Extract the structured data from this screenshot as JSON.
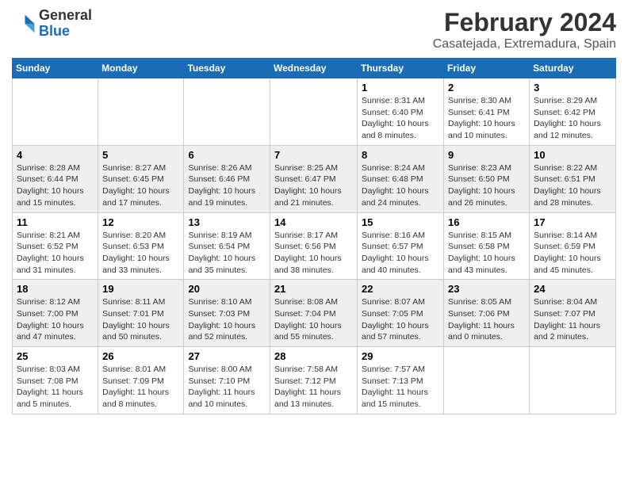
{
  "header": {
    "logo_general": "General",
    "logo_blue": "Blue",
    "month": "February 2024",
    "location": "Casatejada, Extremadura, Spain"
  },
  "columns": [
    "Sunday",
    "Monday",
    "Tuesday",
    "Wednesday",
    "Thursday",
    "Friday",
    "Saturday"
  ],
  "weeks": [
    [
      {
        "day": "",
        "info": ""
      },
      {
        "day": "",
        "info": ""
      },
      {
        "day": "",
        "info": ""
      },
      {
        "day": "",
        "info": ""
      },
      {
        "day": "1",
        "info": "Sunrise: 8:31 AM\nSunset: 6:40 PM\nDaylight: 10 hours\nand 8 minutes."
      },
      {
        "day": "2",
        "info": "Sunrise: 8:30 AM\nSunset: 6:41 PM\nDaylight: 10 hours\nand 10 minutes."
      },
      {
        "day": "3",
        "info": "Sunrise: 8:29 AM\nSunset: 6:42 PM\nDaylight: 10 hours\nand 12 minutes."
      }
    ],
    [
      {
        "day": "4",
        "info": "Sunrise: 8:28 AM\nSunset: 6:44 PM\nDaylight: 10 hours\nand 15 minutes."
      },
      {
        "day": "5",
        "info": "Sunrise: 8:27 AM\nSunset: 6:45 PM\nDaylight: 10 hours\nand 17 minutes."
      },
      {
        "day": "6",
        "info": "Sunrise: 8:26 AM\nSunset: 6:46 PM\nDaylight: 10 hours\nand 19 minutes."
      },
      {
        "day": "7",
        "info": "Sunrise: 8:25 AM\nSunset: 6:47 PM\nDaylight: 10 hours\nand 21 minutes."
      },
      {
        "day": "8",
        "info": "Sunrise: 8:24 AM\nSunset: 6:48 PM\nDaylight: 10 hours\nand 24 minutes."
      },
      {
        "day": "9",
        "info": "Sunrise: 8:23 AM\nSunset: 6:50 PM\nDaylight: 10 hours\nand 26 minutes."
      },
      {
        "day": "10",
        "info": "Sunrise: 8:22 AM\nSunset: 6:51 PM\nDaylight: 10 hours\nand 28 minutes."
      }
    ],
    [
      {
        "day": "11",
        "info": "Sunrise: 8:21 AM\nSunset: 6:52 PM\nDaylight: 10 hours\nand 31 minutes."
      },
      {
        "day": "12",
        "info": "Sunrise: 8:20 AM\nSunset: 6:53 PM\nDaylight: 10 hours\nand 33 minutes."
      },
      {
        "day": "13",
        "info": "Sunrise: 8:19 AM\nSunset: 6:54 PM\nDaylight: 10 hours\nand 35 minutes."
      },
      {
        "day": "14",
        "info": "Sunrise: 8:17 AM\nSunset: 6:56 PM\nDaylight: 10 hours\nand 38 minutes."
      },
      {
        "day": "15",
        "info": "Sunrise: 8:16 AM\nSunset: 6:57 PM\nDaylight: 10 hours\nand 40 minutes."
      },
      {
        "day": "16",
        "info": "Sunrise: 8:15 AM\nSunset: 6:58 PM\nDaylight: 10 hours\nand 43 minutes."
      },
      {
        "day": "17",
        "info": "Sunrise: 8:14 AM\nSunset: 6:59 PM\nDaylight: 10 hours\nand 45 minutes."
      }
    ],
    [
      {
        "day": "18",
        "info": "Sunrise: 8:12 AM\nSunset: 7:00 PM\nDaylight: 10 hours\nand 47 minutes."
      },
      {
        "day": "19",
        "info": "Sunrise: 8:11 AM\nSunset: 7:01 PM\nDaylight: 10 hours\nand 50 minutes."
      },
      {
        "day": "20",
        "info": "Sunrise: 8:10 AM\nSunset: 7:03 PM\nDaylight: 10 hours\nand 52 minutes."
      },
      {
        "day": "21",
        "info": "Sunrise: 8:08 AM\nSunset: 7:04 PM\nDaylight: 10 hours\nand 55 minutes."
      },
      {
        "day": "22",
        "info": "Sunrise: 8:07 AM\nSunset: 7:05 PM\nDaylight: 10 hours\nand 57 minutes."
      },
      {
        "day": "23",
        "info": "Sunrise: 8:05 AM\nSunset: 7:06 PM\nDaylight: 11 hours\nand 0 minutes."
      },
      {
        "day": "24",
        "info": "Sunrise: 8:04 AM\nSunset: 7:07 PM\nDaylight: 11 hours\nand 2 minutes."
      }
    ],
    [
      {
        "day": "25",
        "info": "Sunrise: 8:03 AM\nSunset: 7:08 PM\nDaylight: 11 hours\nand 5 minutes."
      },
      {
        "day": "26",
        "info": "Sunrise: 8:01 AM\nSunset: 7:09 PM\nDaylight: 11 hours\nand 8 minutes."
      },
      {
        "day": "27",
        "info": "Sunrise: 8:00 AM\nSunset: 7:10 PM\nDaylight: 11 hours\nand 10 minutes."
      },
      {
        "day": "28",
        "info": "Sunrise: 7:58 AM\nSunset: 7:12 PM\nDaylight: 11 hours\nand 13 minutes."
      },
      {
        "day": "29",
        "info": "Sunrise: 7:57 AM\nSunset: 7:13 PM\nDaylight: 11 hours\nand 15 minutes."
      },
      {
        "day": "",
        "info": ""
      },
      {
        "day": "",
        "info": ""
      }
    ]
  ]
}
